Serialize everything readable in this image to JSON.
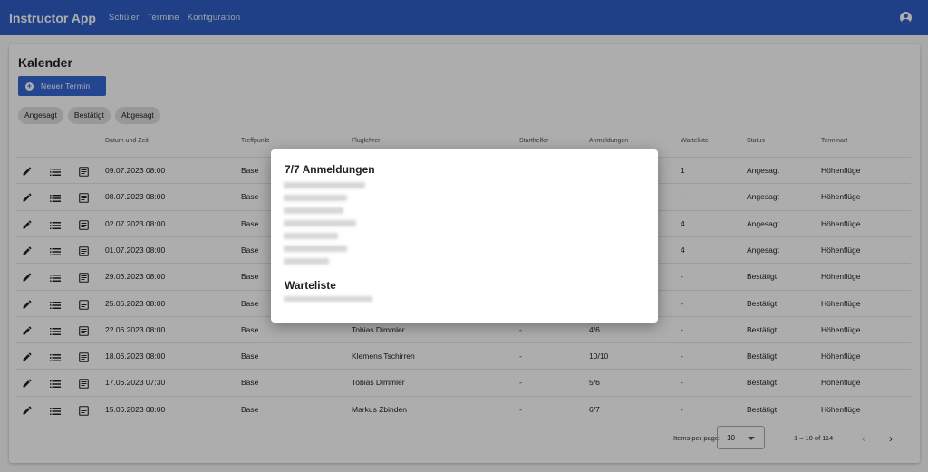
{
  "header": {
    "title": "Instructor App",
    "nav": [
      "Schüler",
      "Termine",
      "Konfiguration"
    ]
  },
  "page": {
    "title": "Kalender",
    "new_button": "Neuer Termin",
    "chips": [
      "Angesagt",
      "Bestätigt",
      "Abgesagt"
    ]
  },
  "table": {
    "headers": [
      "Datum und Zeit",
      "Treffpunkt",
      "Fluglehrer",
      "Starthelfer",
      "Anmeldungen",
      "Warteliste",
      "Status",
      "Terminart"
    ],
    "rows": [
      {
        "date": "09.07.2023 08:00",
        "place": "Base",
        "instructor": "",
        "helper": "",
        "signups": "",
        "waitlist": "1",
        "status": "Angesagt",
        "type": "Höhenflüge"
      },
      {
        "date": "08.07.2023 08:00",
        "place": "Base",
        "instructor": "",
        "helper": "",
        "signups": "",
        "waitlist": "-",
        "status": "Angesagt",
        "type": "Höhenflüge"
      },
      {
        "date": "02.07.2023 08:00",
        "place": "Base",
        "instructor": "",
        "helper": "",
        "signups": "",
        "waitlist": "4",
        "status": "Angesagt",
        "type": "Höhenflüge"
      },
      {
        "date": "01.07.2023 08:00",
        "place": "Base",
        "instructor": "",
        "helper": "",
        "signups": "",
        "waitlist": "4",
        "status": "Angesagt",
        "type": "Höhenflüge"
      },
      {
        "date": "29.06.2023 08:00",
        "place": "Base",
        "instructor": "",
        "helper": "",
        "signups": "",
        "waitlist": "-",
        "status": "Bestätigt",
        "type": "Höhenflüge"
      },
      {
        "date": "25.06.2023 08:00",
        "place": "Base",
        "instructor": "",
        "helper": "",
        "signups": "",
        "waitlist": "-",
        "status": "Bestätigt",
        "type": "Höhenflüge"
      },
      {
        "date": "22.06.2023 08:00",
        "place": "Base",
        "instructor": "Tobias Dimmler",
        "helper": "-",
        "signups": "4/6",
        "waitlist": "-",
        "status": "Bestätigt",
        "type": "Höhenflüge"
      },
      {
        "date": "18.06.2023 08:00",
        "place": "Base",
        "instructor": "Klemens Tschirren",
        "helper": "-",
        "signups": "10/10",
        "waitlist": "-",
        "status": "Bestätigt",
        "type": "Höhenflüge"
      },
      {
        "date": "17.06.2023 07:30",
        "place": "Base",
        "instructor": "Tobias Dimmler",
        "helper": "-",
        "signups": "5/6",
        "waitlist": "-",
        "status": "Bestätigt",
        "type": "Höhenflüge"
      },
      {
        "date": "15.06.2023 08:00",
        "place": "Base",
        "instructor": "Markus Zbinden",
        "helper": "-",
        "signups": "6/7",
        "waitlist": "-",
        "status": "Bestätigt",
        "type": "Höhenflüge"
      }
    ]
  },
  "pagination": {
    "items_label": "Items per page:",
    "page_size": "10",
    "range": "1 – 10 of 114"
  },
  "dialog": {
    "title": "7/7 Anmeldungen",
    "waitlist_title": "Warteliste"
  }
}
